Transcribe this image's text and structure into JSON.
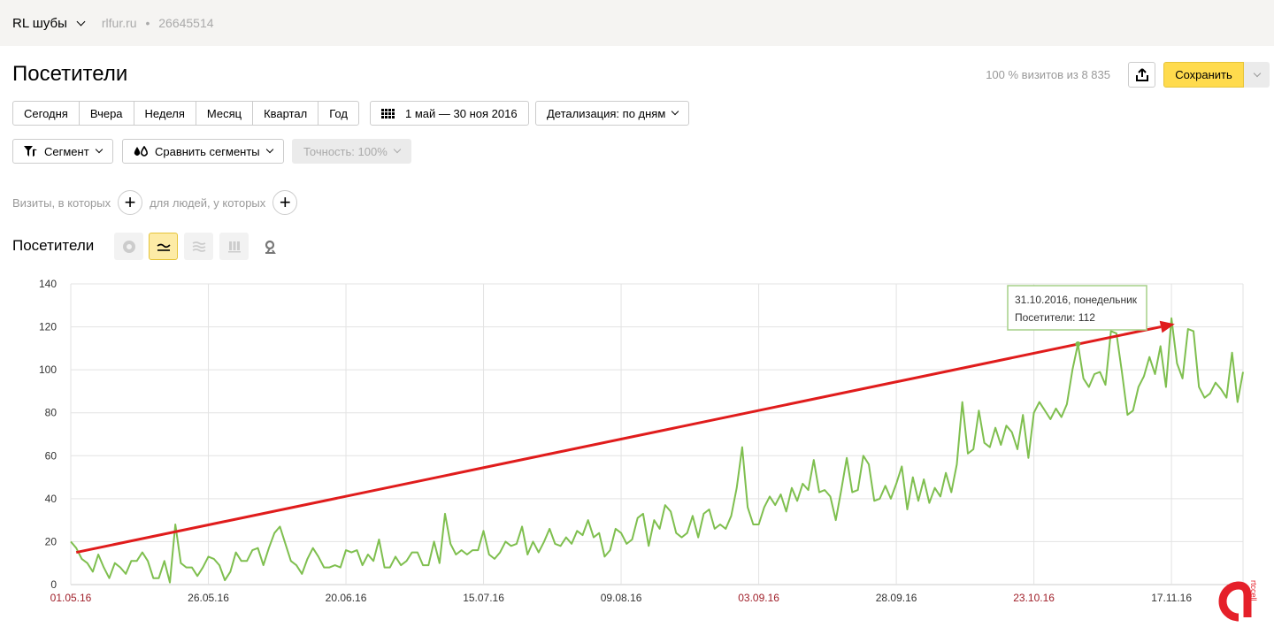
{
  "topbar": {
    "counter_name": "RL шубы",
    "site": "rlfur.ru",
    "separator": "•",
    "counter_id": "26645514"
  },
  "page": {
    "title": "Посетители",
    "visits_info": "100 % визитов из 8 835",
    "save_label": "Сохранить"
  },
  "periods": [
    "Сегодня",
    "Вчера",
    "Неделя",
    "Месяц",
    "Квартал",
    "Год"
  ],
  "date_range": "1 май — 30 ноя 2016",
  "detail": "Детализация: по дням",
  "segment_label": "Сегмент",
  "compare_label": "Сравнить сегменты",
  "accuracy_label": "Точность: 100%",
  "filters": {
    "visits_label": "Визиты, в которых",
    "people_label": "для людей, у которых"
  },
  "chart_header": {
    "title": "Посетители",
    "types": [
      "pie-chart",
      "line-chart",
      "area-chart",
      "bar-chart",
      "map"
    ],
    "active_type": "line-chart"
  },
  "colors": {
    "line": "#7fbf4f",
    "arrow": "#e01c1c",
    "save": "#ffdb4d",
    "weekend_label": "#a0202a"
  },
  "chart_data": {
    "type": "line",
    "title": "Посетители",
    "xlabel": "",
    "ylabel": "",
    "ylim": [
      0,
      140
    ],
    "yticks": [
      0,
      20,
      40,
      60,
      80,
      100,
      120,
      140
    ],
    "grid": true,
    "x_start": "01.05.2016",
    "x_end": "30.11.2016",
    "xticks": [
      {
        "label": "01.05.16",
        "day": 0,
        "weekend": true
      },
      {
        "label": "26.05.16",
        "day": 25,
        "weekend": false
      },
      {
        "label": "20.06.16",
        "day": 50,
        "weekend": false
      },
      {
        "label": "15.07.16",
        "day": 75,
        "weekend": false
      },
      {
        "label": "09.08.16",
        "day": 100,
        "weekend": false
      },
      {
        "label": "03.09.16",
        "day": 125,
        "weekend": true
      },
      {
        "label": "28.09.16",
        "day": 150,
        "weekend": false
      },
      {
        "label": "23.10.16",
        "day": 175,
        "weekend": true
      },
      {
        "label": "17.11.16",
        "day": 200,
        "weekend": false
      }
    ],
    "series": [
      {
        "name": "Посетители",
        "values": [
          20,
          17,
          12,
          10,
          6,
          14,
          8,
          3,
          10,
          8,
          5,
          11,
          11,
          15,
          11,
          3,
          3,
          11,
          1,
          28,
          10,
          8,
          8,
          4,
          8,
          13,
          12,
          9,
          2,
          6,
          15,
          11,
          11,
          16,
          17,
          9,
          17,
          24,
          27,
          19,
          11,
          9,
          5,
          12,
          17,
          13,
          8,
          8,
          9,
          8,
          16,
          15,
          16,
          9,
          14,
          11,
          21,
          8,
          8,
          13,
          9,
          11,
          15,
          15,
          9,
          9,
          20,
          10,
          33,
          19,
          14,
          16,
          14,
          16,
          16,
          25,
          14,
          12,
          15,
          20,
          18,
          19,
          27,
          14,
          20,
          15,
          20,
          26,
          19,
          18,
          22,
          19,
          25,
          23,
          30,
          22,
          24,
          13,
          16,
          26,
          24,
          19,
          21,
          31,
          33,
          18,
          30,
          26,
          37,
          34,
          24,
          22,
          24,
          32,
          22,
          33,
          35,
          26,
          28,
          26,
          32,
          45,
          64,
          36,
          28,
          28,
          36,
          41,
          37,
          42,
          34,
          45,
          39,
          47,
          44,
          58,
          43,
          44,
          41,
          30,
          44,
          59,
          43,
          44,
          60,
          56,
          39,
          40,
          46,
          40,
          47,
          55,
          35,
          50,
          39,
          49,
          38,
          45,
          41,
          52,
          43,
          56,
          85,
          61,
          63,
          81,
          66,
          64,
          73,
          65,
          74,
          71,
          63,
          79,
          59,
          80,
          85,
          81,
          77,
          82,
          78,
          84,
          100,
          112,
          96,
          92,
          98,
          99,
          93,
          118,
          117,
          99,
          79,
          81,
          92,
          97,
          106,
          98,
          111,
          92,
          124,
          103,
          96,
          119,
          118,
          92,
          87,
          89,
          94,
          91,
          87,
          108,
          85,
          99
        ]
      }
    ],
    "tooltip": {
      "date": "31.10.2016, понедельник",
      "label": "Посетители: 112",
      "day": 183
    },
    "annotation": {
      "type": "trend-arrow",
      "from": {
        "day": 1,
        "value": 15
      },
      "to": {
        "day": 200,
        "value": 120
      }
    }
  }
}
